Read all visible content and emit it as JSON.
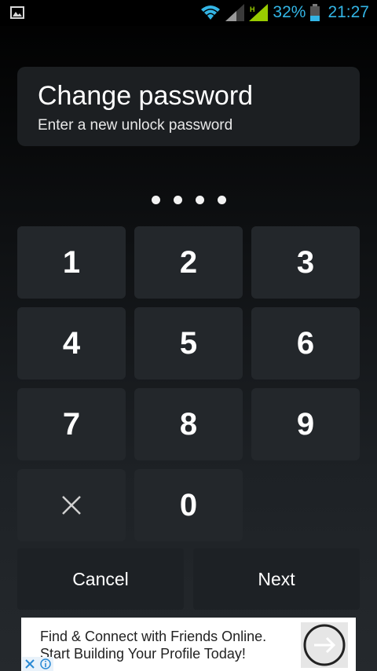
{
  "status_bar": {
    "battery_percent": "32%",
    "time": "21:27",
    "icons": [
      "gallery-icon",
      "wifi-icon",
      "signal-icon",
      "battery-icon"
    ],
    "accent_color": "#33b5e5"
  },
  "header": {
    "title": "Change password",
    "subtitle": "Enter a new unlock password"
  },
  "password_dots": 4,
  "keypad": {
    "keys": [
      "1",
      "2",
      "3",
      "4",
      "5",
      "6",
      "7",
      "8",
      "9",
      "0"
    ],
    "delete_icon": "close-icon"
  },
  "actions": {
    "cancel_label": "Cancel",
    "next_label": "Next"
  },
  "ad": {
    "line1": "Find & Connect with Friends Online.",
    "line2": "Start Building Your Profile Today!",
    "icons": [
      "arrow-right-icon",
      "close-icon",
      "info-icon"
    ]
  }
}
